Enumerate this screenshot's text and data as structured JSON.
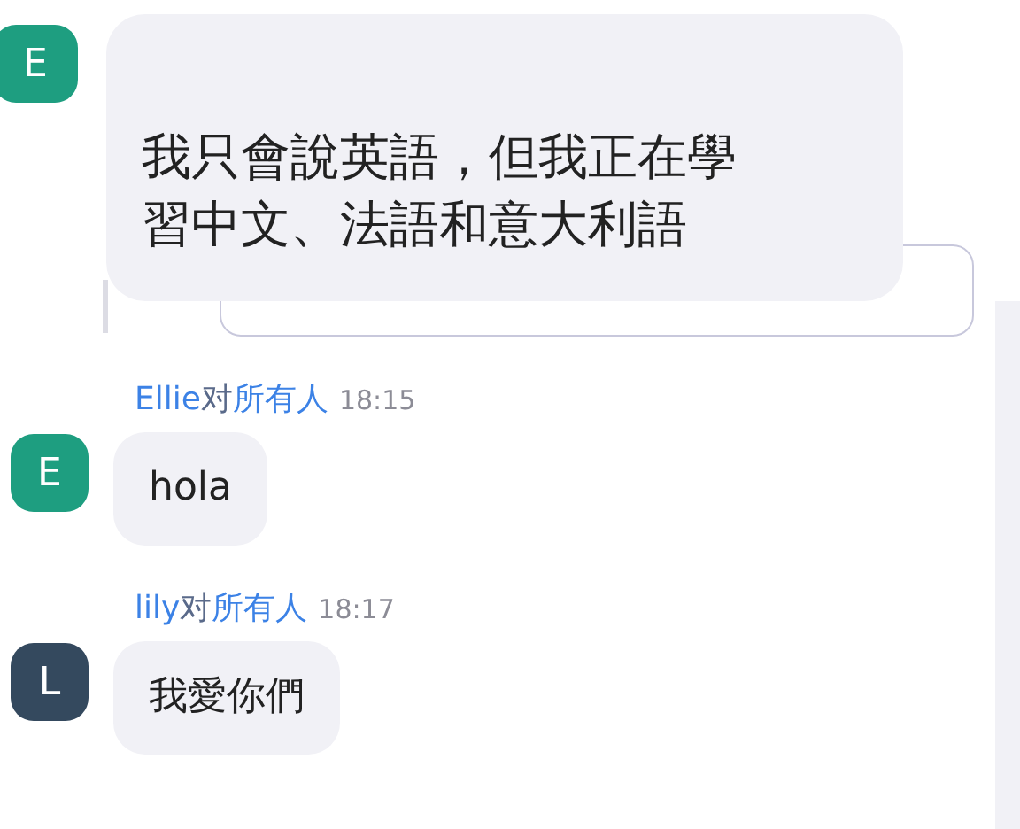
{
  "messages": [
    {
      "avatar": "E",
      "color": "#1e9e80",
      "text": "我只會說英語，但我正在學習中文、法語和意大利語"
    },
    {
      "sender": "Ellie",
      "to_word": "对",
      "recipient": "所有人",
      "time": "18:15",
      "avatar": "E",
      "color": "#1e9e80",
      "text": "hola"
    },
    {
      "sender": "lily",
      "to_word": "对",
      "recipient": "所有人",
      "time": "18:17",
      "avatar": "L",
      "color": "#34495e",
      "text": "我愛你們"
    }
  ]
}
